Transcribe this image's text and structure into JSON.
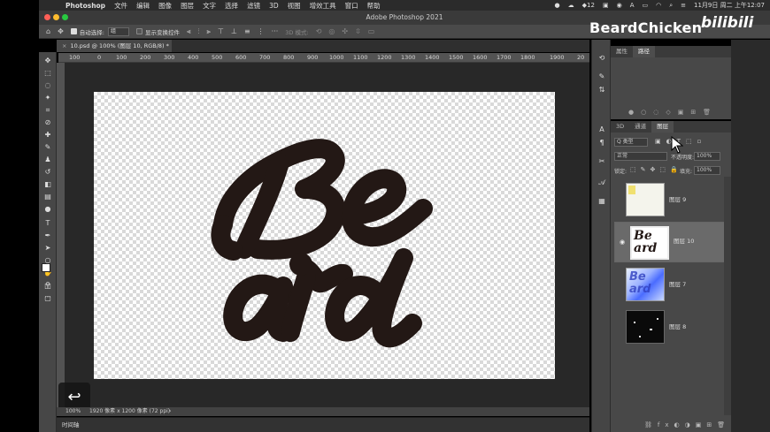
{
  "menubar": {
    "app": "Photoshop",
    "items": [
      "文件",
      "编辑",
      "图像",
      "图层",
      "文字",
      "选择",
      "滤镜",
      "3D",
      "视图",
      "增效工具",
      "窗口",
      "帮助"
    ],
    "status": {
      "battery_badge": "12",
      "datetime": "11月9日 周二 上午12:07"
    }
  },
  "titlebar": {
    "title": "Adobe Photoshop 2021"
  },
  "options": {
    "auto_select_label": "自动选择:",
    "auto_select_value": "组",
    "transform_label": "显示变换控件",
    "mode_3d": "3D 模式:"
  },
  "document": {
    "tab_label": "10.psd @ 100% (图层 10, RGB/8) *"
  },
  "ruler": {
    "top_ticks": [
      "100",
      "0",
      "100",
      "200",
      "300",
      "400",
      "500",
      "600",
      "700",
      "800",
      "900",
      "1000",
      "1100",
      "1200",
      "1300",
      "1400",
      "1500",
      "1600",
      "1700",
      "1800",
      "1900",
      "20"
    ]
  },
  "canvas": {
    "artwork_text_line1": "Be",
    "artwork_text_line2": "ard",
    "artwork_color": "#231815"
  },
  "status": {
    "zoom": "100%",
    "doc_info": "1920 像素 x 1200 像素 (72 ppi)"
  },
  "timeline": {
    "label": "时间轴"
  },
  "panels": {
    "top_tabs": [
      "属性",
      "路径"
    ],
    "layer_tabs": [
      "3D",
      "通道",
      "图层"
    ],
    "filter_label": "Q 类型",
    "blend_mode": "正常",
    "opacity_label": "不透明度:",
    "opacity_value": "100%",
    "lock_label": "锁定:",
    "fill_label": "填充:",
    "fill_value": "100%",
    "layers": [
      {
        "name": "图层 9",
        "selected": false,
        "visible": false
      },
      {
        "name": "图层 10",
        "selected": true,
        "visible": true
      },
      {
        "name": "图层 7",
        "selected": false,
        "visible": false
      },
      {
        "name": "图层 8",
        "selected": false,
        "visible": false
      }
    ]
  },
  "watermark": {
    "channel": "BeardChicken",
    "site": "bilibili"
  }
}
